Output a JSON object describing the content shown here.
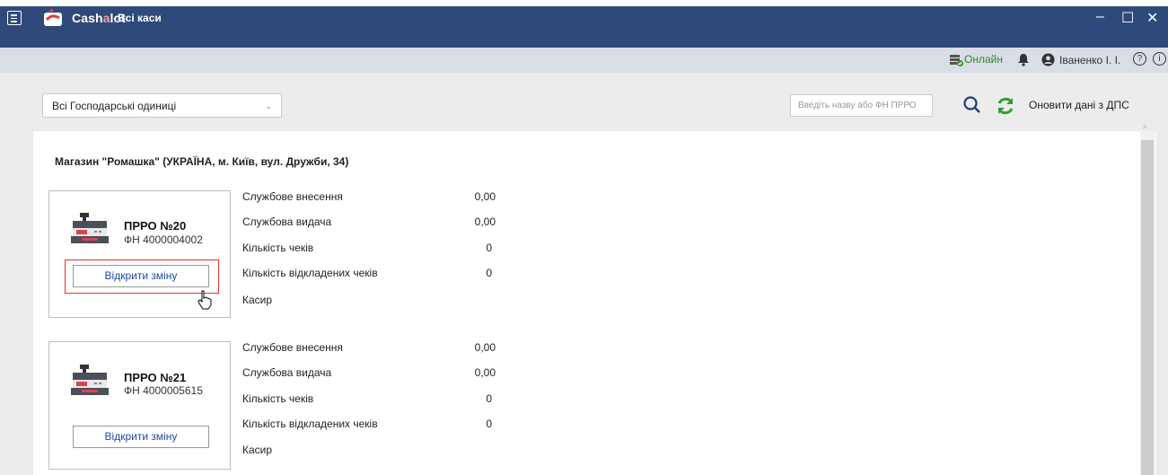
{
  "window": {
    "brand": "Cashalot",
    "brand_prefix": "Cash",
    "brand_accent": "a",
    "brand_suffix": "lot",
    "title": "Всі каси",
    "controls": {
      "minimize": "–",
      "maximize": "☐",
      "close": "✕"
    }
  },
  "status": {
    "online_label": "Онлайн",
    "user_name": "Іваненко І. І.",
    "help": "?",
    "info": "i"
  },
  "toolbar": {
    "dropdown_value": "Всі Господарські одиниці",
    "search_placeholder": "Введіть назву або ФН ПРРО",
    "refresh_label": "Оновити дані з ДПС"
  },
  "shop": {
    "title": "Магазин \"Ромашка\" (УКРАЇНА, м. Київ, вул. Дружби, 34)"
  },
  "registers": [
    {
      "name": "ПРРО №20",
      "fn": "ФН 4000004002",
      "open_button": "Відкрити зміну",
      "stats": [
        {
          "label": "Службове внесення",
          "value": "0,00"
        },
        {
          "label": "Службова видача",
          "value": "0,00"
        },
        {
          "label": "Кількість чеків",
          "value": "0"
        },
        {
          "label": "Кількість відкладених чеків",
          "value": "0"
        },
        {
          "label": "Касир",
          "value": ""
        }
      ]
    },
    {
      "name": "ПРРО №21",
      "fn": "ФН 4000005615",
      "open_button": "Відкрити зміну",
      "stats": [
        {
          "label": "Службове внесення",
          "value": "0,00"
        },
        {
          "label": "Службова видача",
          "value": "0,00"
        },
        {
          "label": "Кількість чеків",
          "value": "0"
        },
        {
          "label": "Кількість відкладених чеків",
          "value": "0"
        },
        {
          "label": "Касир",
          "value": ""
        }
      ]
    }
  ],
  "colors": {
    "titlebar": "#2e4a7a",
    "statusbar": "#d9dde6",
    "online": "#2e8a2e",
    "highlight": "#e03030",
    "link": "#1f4aa0"
  }
}
